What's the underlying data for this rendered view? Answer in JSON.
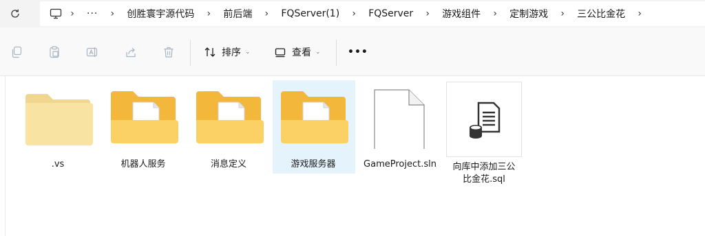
{
  "breadcrumbs": [
    "创胜寰宇源代码",
    "前后端",
    "FQServer(1)",
    "FQServer",
    "游戏组件",
    "定制游戏",
    "三公比金花"
  ],
  "breadcrumb_more": "···",
  "toolbar": {
    "sort_label": "排序",
    "view_label": "查看",
    "more_label": "•••"
  },
  "files": [
    {
      "name": ".vs",
      "type": "folder-empty"
    },
    {
      "name": "机器人服务",
      "type": "folder"
    },
    {
      "name": "消息定义",
      "type": "folder"
    },
    {
      "name": "游戏服务器",
      "type": "folder",
      "selected": true
    },
    {
      "name": "GameProject.sln",
      "type": "document"
    },
    {
      "name_line1": "向库中添加三公",
      "name_line2": "比金花.sql",
      "type": "sql"
    }
  ]
}
